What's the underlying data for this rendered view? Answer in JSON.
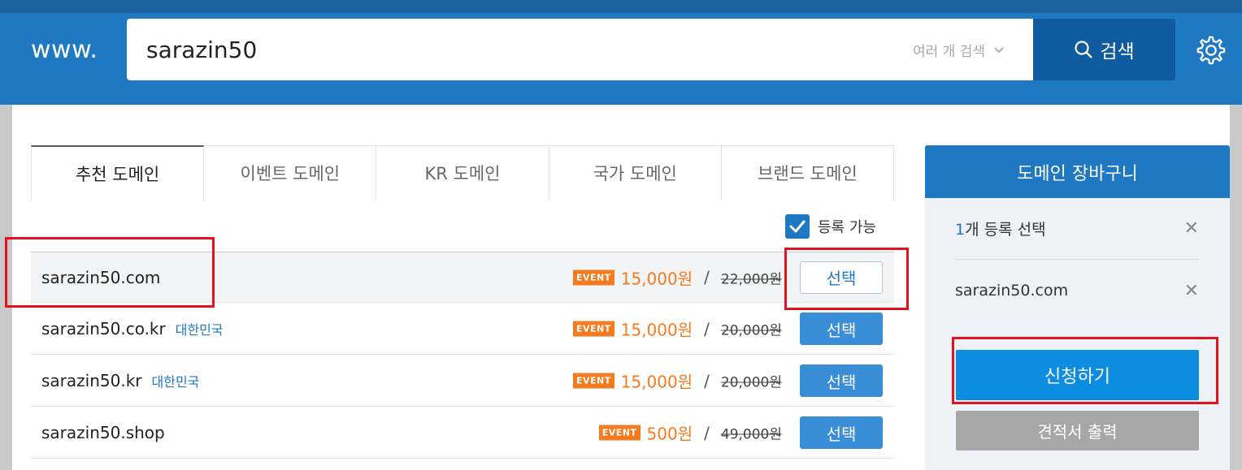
{
  "header": {
    "logo": "www.",
    "search_value": "sarazin50",
    "multi_search_label": "여러 개 검색",
    "search_button_label": "검색"
  },
  "tabs": [
    {
      "label": "추천 도메인",
      "active": true
    },
    {
      "label": "이벤트 도메인",
      "active": false
    },
    {
      "label": "KR 도메인",
      "active": false
    },
    {
      "label": "국가 도메인",
      "active": false
    },
    {
      "label": "브랜드 도메인",
      "active": false
    }
  ],
  "filter": {
    "label": "등록 가능",
    "checked": true
  },
  "domains": [
    {
      "name": "sarazin50.com",
      "country": "",
      "badge": "EVENT",
      "price": "15,000원",
      "original": "22,000원",
      "button": "선택",
      "selected": true
    },
    {
      "name": "sarazin50.co.kr",
      "country": "대한민국",
      "badge": "EVENT",
      "price": "15,000원",
      "original": "20,000원",
      "button": "선택",
      "selected": false
    },
    {
      "name": "sarazin50.kr",
      "country": "대한민국",
      "badge": "EVENT",
      "price": "15,000원",
      "original": "20,000원",
      "button": "선택",
      "selected": false
    },
    {
      "name": "sarazin50.shop",
      "country": "",
      "badge": "EVENT",
      "price": "500원",
      "original": "49,000원",
      "button": "선택",
      "selected": false
    }
  ],
  "slash": "/",
  "cart": {
    "title": "도메인 장바구니",
    "count_num": "1",
    "count_text": "개 등록 선택",
    "item": "sarazin50.com",
    "apply_label": "신청하기",
    "quote_label": "견적서 출력"
  },
  "colors": {
    "header_bg": "#1f78c2",
    "accent_orange": "#f47b20",
    "highlight_red": "#e3121f"
  }
}
